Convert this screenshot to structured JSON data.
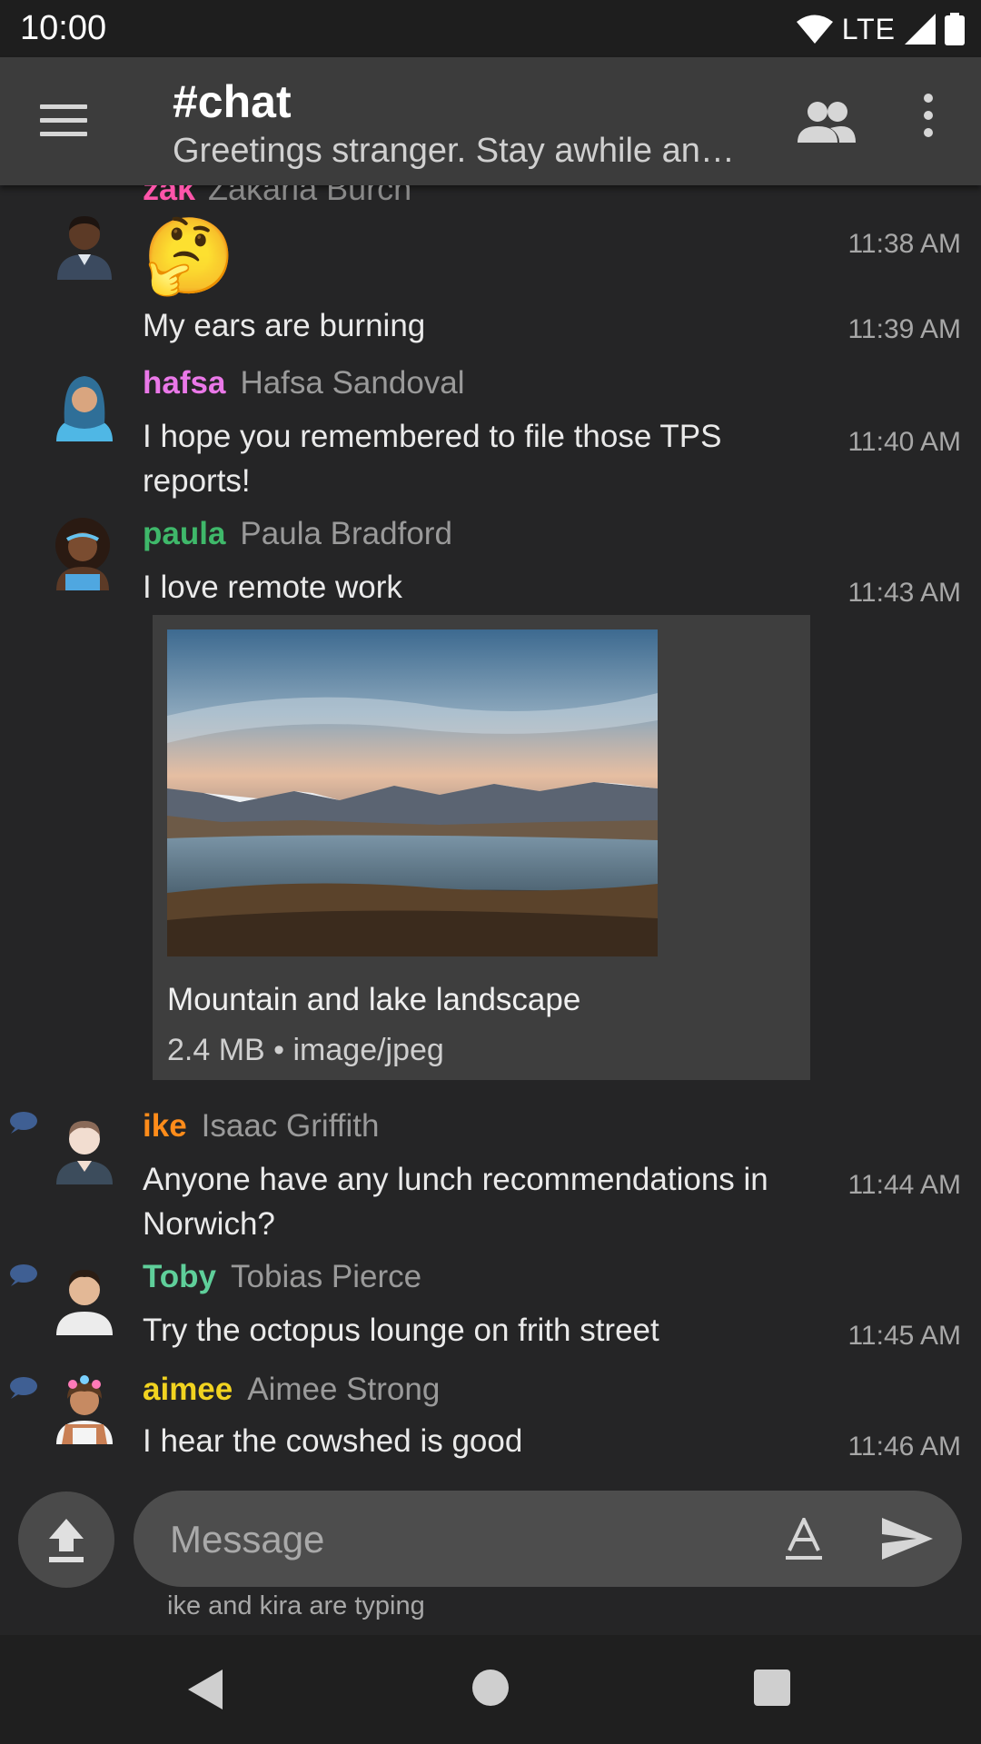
{
  "status": {
    "time": "10:00",
    "network": "LTE"
  },
  "channel": {
    "title": "#chat",
    "topic": "Greetings stranger. Stay awhile an…"
  },
  "colors": {
    "zak": "#ff55aa",
    "hafsa": "#ea78e8",
    "paula": "#3fb86a",
    "ike": "#ff8c1a",
    "toby": "#5fcf9a",
    "aimee": "#f1d320"
  },
  "cut_sender": {
    "nick": "zak",
    "full": "Zakaria Burch"
  },
  "messages": [
    {
      "emoji": "🤔",
      "time": "11:38 AM"
    },
    {
      "text": "My ears are burning",
      "time": "11:39 AM"
    },
    {
      "nick": "hafsa",
      "full": "Hafsa Sandoval",
      "text": "I hope you remembered to file those TPS reports!",
      "time": "11:40 AM"
    },
    {
      "nick": "paula",
      "full": "Paula Bradford",
      "text": "I love remote work",
      "time": "11:43 AM"
    },
    {
      "nick": "ike",
      "full": "Isaac Griffith",
      "text": "Anyone have any lunch recommendations in Norwich?",
      "time": "11:44 AM"
    },
    {
      "nick": "Toby",
      "full": "Tobias Pierce",
      "text": "Try the octopus lounge on frith street",
      "time": "11:45 AM"
    },
    {
      "nick": "aimee",
      "full": "Aimee Strong",
      "text": "I hear the cowshed is good",
      "time": "11:46 AM"
    }
  ],
  "attachment": {
    "title": "Mountain and lake landscape",
    "meta": "2.4 MB • image/jpeg"
  },
  "composer": {
    "placeholder": "Message"
  },
  "typing": "ike and kira are typing",
  "icons": {
    "menu": "hamburger-icon",
    "members": "people-icon",
    "more": "more-vert-icon",
    "upload": "upload-icon",
    "format": "text-format-icon",
    "send": "send-icon",
    "thread": "thread-bubble-icon"
  }
}
